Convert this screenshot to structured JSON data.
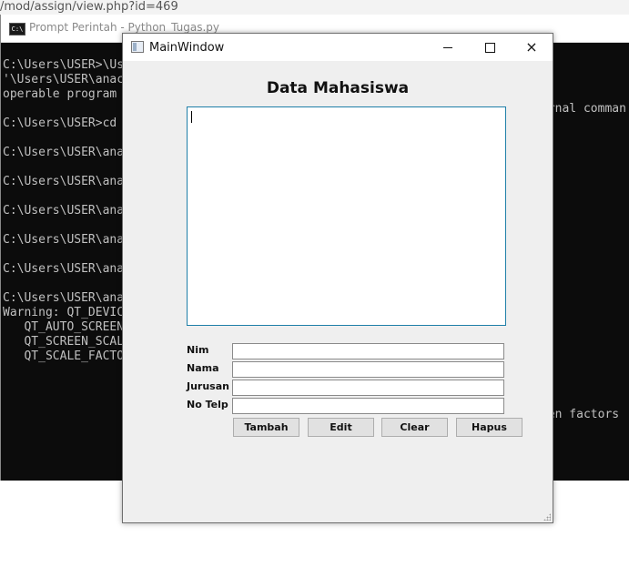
{
  "browser": {
    "url_fragment": "/mod/assign/view.php?id=469"
  },
  "console": {
    "title": "Prompt Perintah - Python_Tugas.py",
    "icon_text": "C:\\",
    "lines": [
      "C:\\Users\\USER>\\Us",
      "'\\Users\\USER\\anac",
      "operable program",
      "",
      "C:\\Users\\USER>cd",
      "",
      "C:\\Users\\USER\\ana",
      "",
      "C:\\Users\\USER\\ana",
      "",
      "C:\\Users\\USER\\ana",
      "",
      "C:\\Users\\USER\\ana",
      "",
      "C:\\Users\\USER\\ana",
      "",
      "C:\\Users\\USER\\ana",
      "Warning: QT_DEVIC",
      "   QT_AUTO_SCREEN",
      "   QT_SCREEN_SCAL",
      "   QT_SCALE_FACTO"
    ],
    "right_fragments": {
      "line2": "ernal comman",
      "line19": "een factors"
    }
  },
  "window": {
    "title": "MainWindow",
    "heading": "Data Mahasiswa",
    "controls": {
      "minimize": "minimize",
      "maximize": "maximize",
      "close": "×"
    }
  },
  "form": {
    "fields": [
      {
        "label": "Nim",
        "value": ""
      },
      {
        "label": "Nama",
        "value": ""
      },
      {
        "label": "Jurusan",
        "value": ""
      },
      {
        "label": "No Telp",
        "value": ""
      }
    ],
    "buttons": {
      "tambah": "Tambah",
      "edit": "Edit",
      "clear": "Clear",
      "hapus": "Hapus"
    }
  },
  "textarea": {
    "value": ""
  },
  "colors": {
    "console_bg": "#0c0c0c",
    "console_text": "#c0c0c0",
    "window_bg": "#efefef",
    "textarea_border": "#1e7fa8",
    "button_bg": "#e1e1e1"
  },
  "icons": {
    "console": "cmd-icon",
    "app": "window-icon",
    "minimize": "minimize-icon",
    "maximize": "maximize-icon",
    "close": "close-icon",
    "resize": "resize-grip-icon"
  }
}
